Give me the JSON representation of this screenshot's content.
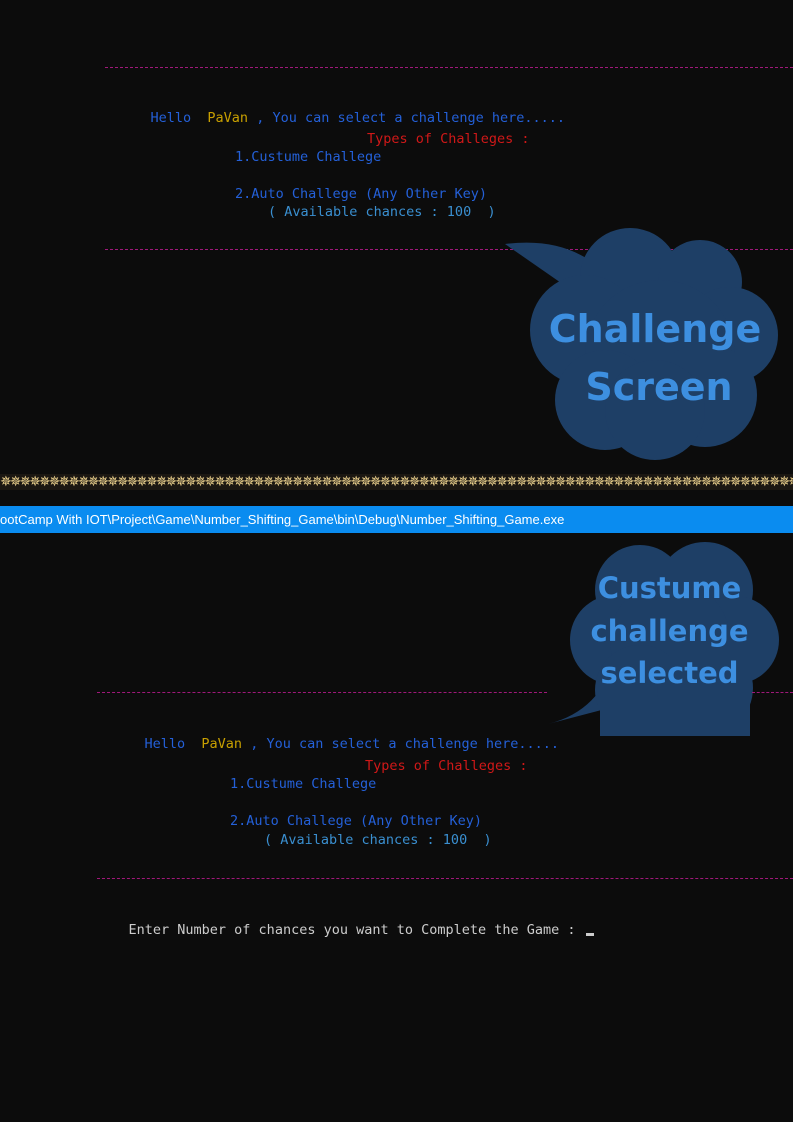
{
  "top_console": {
    "greeting_hello": "Hello",
    "user_name": "PaVan",
    "greeting_rest": ", You can select a challenge here.....",
    "types_header": "Types of Challeges :",
    "option_1": "1.Custume Challege",
    "option_2": "2.Auto Challege (Any Other Key)",
    "available_chances": "( Available chances : 100  )"
  },
  "callout_1": {
    "line_1": "Challenge",
    "line_2": "Screen"
  },
  "title_bar": {
    "path": "ootCamp With IOT\\Project\\Game\\Number_Shifting_Game\\bin\\Debug\\Number_Shifting_Game.exe"
  },
  "callout_2": {
    "line_1": "Custume",
    "line_2": "challenge",
    "line_3": "selected"
  },
  "bottom_console": {
    "greeting_hello": "Hello",
    "user_name": "PaVan",
    "greeting_rest": ", You can select a challenge here.....",
    "types_header": "Types of Challeges :",
    "option_1": "1.Custume Challege",
    "option_2": "2.Auto Challege (Any Other Key)",
    "available_chances": "( Available chances : 100  )",
    "prompt": "Enter Number of chances you want to Complete the Game :"
  },
  "colors": {
    "background": "#0c0c0c",
    "dashed_line": "#a0187a",
    "text_blue": "#2460d8",
    "name_yellow": "#c8a000",
    "header_red": "#d01818",
    "chances_cyan": "#3a8fd0",
    "bubble_fill": "#1e3f66",
    "bubble_text": "#3d8fe0",
    "titlebar_blue": "#0a8cf0"
  }
}
